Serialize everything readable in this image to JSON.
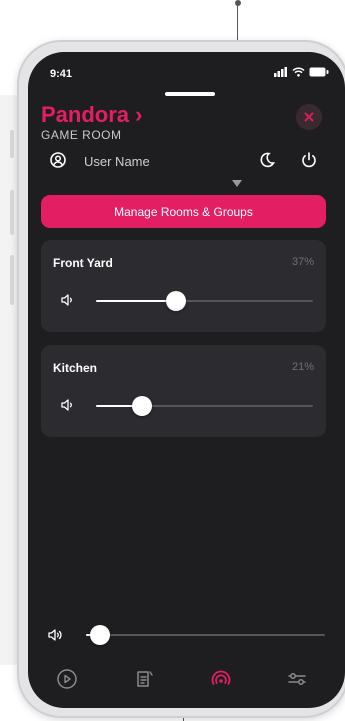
{
  "status_bar": {
    "time": "9:41"
  },
  "header": {
    "title": "Pandora ›",
    "subtitle": "GAME ROOM"
  },
  "user": {
    "name": "User Name"
  },
  "manage_button": {
    "label": "Manage Rooms & Groups"
  },
  "rooms": [
    {
      "name": "Front Yard",
      "volume_label": "37%",
      "volume": 0.37
    },
    {
      "name": "Kitchen",
      "volume_label": "21%",
      "volume": 0.21
    }
  ],
  "master_volume": {
    "volume": 0.06
  },
  "nav": [
    "play",
    "queue",
    "sources",
    "settings"
  ],
  "colors": {
    "accent": "#e31e63",
    "background": "#1e1e21",
    "card": "#2c2c30"
  }
}
